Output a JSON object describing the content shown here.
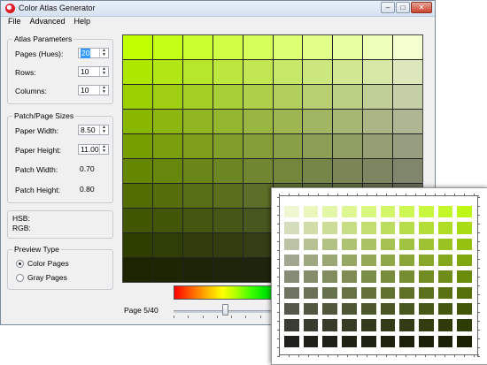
{
  "window": {
    "title": "Color Atlas Generator",
    "buttons": {
      "minimize": "–",
      "maximize": "□",
      "close": "✕"
    }
  },
  "menu": {
    "items": [
      "File",
      "Advanced",
      "Help"
    ]
  },
  "atlas_parameters": {
    "title": "Atlas Parameters",
    "pages_label": "Pages (Hues):",
    "pages_value": "20",
    "rows_label": "Rows:",
    "rows_value": "10",
    "columns_label": "Columns:",
    "columns_value": "10"
  },
  "patch_sizes": {
    "title": "Patch/Page Sizes",
    "paper_width_label": "Paper Width:",
    "paper_width_value": "8.50",
    "paper_height_label": "Paper Height:",
    "paper_height_value": "11.00",
    "patch_width_label": "Patch Width:",
    "patch_width_value": "0.70",
    "patch_height_label": "Patch Height:",
    "patch_height_value": "0.80"
  },
  "color_info": {
    "hsb_label": "HSB:",
    "rgb_label": "RGB:"
  },
  "preview_type": {
    "title": "Preview Type",
    "color_pages_label": "Color Pages",
    "gray_pages_label": "Gray Pages",
    "selected": "Color Pages"
  },
  "page_indicator": {
    "text": "Page 5/40",
    "current": 5,
    "total": 40
  },
  "grid": {
    "rows": 10,
    "columns": 10,
    "hue": 75
  },
  "colors": {
    "accent_selection": "#3399ff",
    "close_button": "#c8422c"
  }
}
